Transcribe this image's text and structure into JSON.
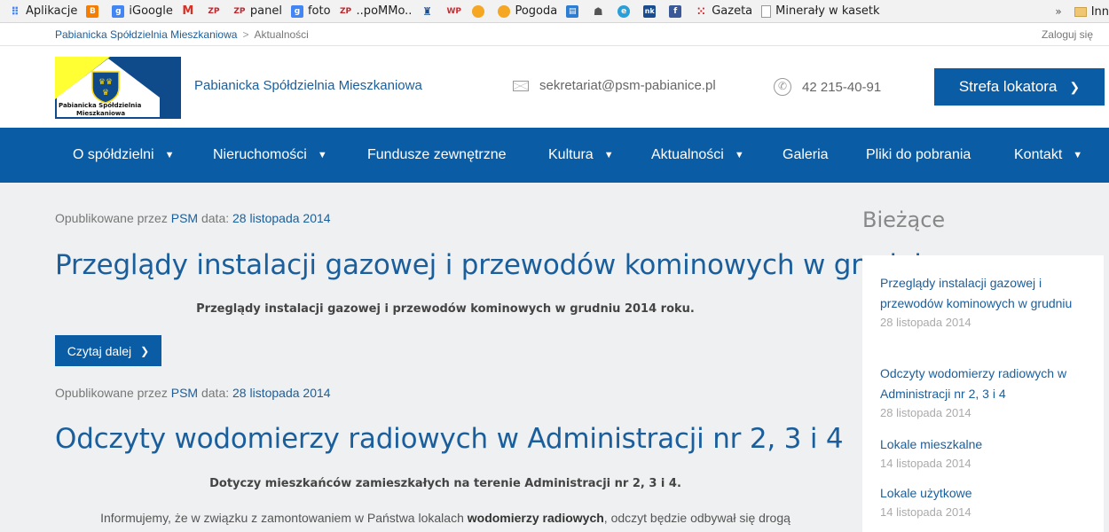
{
  "bookmarks": [
    {
      "label": "Aplikacje",
      "icon": "apps-grid-icon",
      "color": "#4285f4"
    },
    {
      "label": "",
      "icon": "blogger-icon",
      "color": "#f57d00"
    },
    {
      "label": "iGoogle",
      "icon": "google-icon",
      "color": "#4285f4"
    },
    {
      "label": "",
      "icon": "gmail-icon",
      "color": "#d93025"
    },
    {
      "label": "",
      "icon": "zp-icon",
      "color": "#c1272d"
    },
    {
      "label": "panel",
      "icon": "zp-panel-icon",
      "color": "#c1272d"
    },
    {
      "label": "foto",
      "icon": "google-photos-icon",
      "color": "#4285f4"
    },
    {
      "label": "..poMMo..",
      "icon": "zp-pommo-icon",
      "color": "#c1272d"
    },
    {
      "label": "",
      "icon": "crest-icon",
      "color": "#1a4d8f"
    },
    {
      "label": "",
      "icon": "wp-icon",
      "color": "#d7262c"
    },
    {
      "label": "",
      "icon": "orange-ball-icon",
      "color": "#f5a623"
    },
    {
      "label": "Pogoda",
      "icon": "weather-icon",
      "color": "#f5a623"
    },
    {
      "label": "",
      "icon": "news-icon",
      "color": "#2d7ed3"
    },
    {
      "label": "",
      "icon": "robot-icon",
      "color": "#555555"
    },
    {
      "label": "",
      "icon": "browser-icon",
      "color": "#2a9fd8"
    },
    {
      "label": "",
      "icon": "nk-icon",
      "color": "#1a4d8f"
    },
    {
      "label": "",
      "icon": "facebook-icon",
      "color": "#3b5998"
    },
    {
      "label": "Gazeta",
      "icon": "gazeta-icon",
      "color": "#d71920"
    },
    {
      "label": "Minerały w kasetk",
      "icon": "page-icon",
      "color": "#999999"
    }
  ],
  "bookmarks_more": "»",
  "bookmarks_other": "Inn",
  "breadcrumb": {
    "home": "Pabianicka Spółdzielnia Mieszkaniowa",
    "separator": ">",
    "current": "Aktualności"
  },
  "login": "Zaloguj się",
  "logo": {
    "line1": "Pabianicka Spółdzielnia",
    "line2": "Mieszkaniowa"
  },
  "site_name": "Pabianicka Spółdzielnia Mieszkaniowa",
  "email": "sekretariat@psm-pabianice.pl",
  "phone": "42 215-40-91",
  "cta": "Strefa lokatora",
  "nav": [
    {
      "label": "O spółdzielni",
      "dropdown": true
    },
    {
      "label": "Nieruchomości",
      "dropdown": true
    },
    {
      "label": "Fundusze zewnętrzne",
      "dropdown": false
    },
    {
      "label": "Kultura",
      "dropdown": true
    },
    {
      "label": "Aktualności",
      "dropdown": true
    },
    {
      "label": "Galeria",
      "dropdown": false
    },
    {
      "label": "Pliki do pobrania",
      "dropdown": false
    },
    {
      "label": "Kontakt",
      "dropdown": true
    }
  ],
  "posts": [
    {
      "meta_prefix": "Opublikowane przez",
      "author": "PSM",
      "meta_mid": "data:",
      "date": "28 listopada 2014",
      "title": "Przeglądy instalacji gazowej i przewodów kominowych w grudniu",
      "excerpt": "Przeglądy instalacji gazowej i przewodów kominowych w grudniu 2014 roku.",
      "read_more": "Czytaj dalej"
    },
    {
      "meta_prefix": "Opublikowane przez",
      "author": "PSM",
      "meta_mid": "data:",
      "date": "28 listopada 2014",
      "title": "Odczyty wodomierzy radiowych w Administracji nr 2, 3 i 4",
      "excerpt": "Dotyczy mieszkańców zamieszkałych na terenie Administracji nr 2, 3 i 4.",
      "body_before": "Informujemy, że w związku z zamontowaniem w Państwa lokalach",
      "body_bold": "wodomierzy radiowych",
      "body_after": ", odczyt będzie odbywał się drogą"
    }
  ],
  "sidebar": {
    "title": "Bieżące",
    "items": [
      {
        "title": "Przeglądy instalacji gazowej i przewodów kominowych w grudniu",
        "date": "28 listopada 2014"
      },
      {
        "title": "Odczyty wodomierzy radiowych w Administracji nr 2, 3 i 4",
        "date": "28 listopada 2014"
      },
      {
        "title": "Lokale mieszkalne",
        "date": "14 listopada 2014"
      },
      {
        "title": "Lokale użytkowe",
        "date": "14 listopada 2014"
      }
    ]
  },
  "colors": {
    "brand": "#0a5ca5",
    "link": "#1a5e9c",
    "logo_yellow": "#ffff33"
  }
}
